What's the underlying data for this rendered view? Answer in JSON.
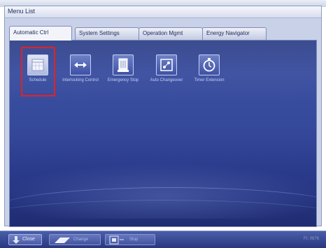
{
  "window": {
    "title": "Menu List"
  },
  "tabs": [
    {
      "label": "Automatic Ctrl",
      "active": true
    },
    {
      "label": "System Settings",
      "active": false
    },
    {
      "label": "Operation Mgmt",
      "active": false
    },
    {
      "label": "Energy Navigator",
      "active": false
    }
  ],
  "menu": {
    "selected": "Schedule",
    "items": [
      {
        "label": "Schedule",
        "icon": "calendar-icon"
      },
      {
        "label": "Interlocking Control",
        "icon": "arrows-icon"
      },
      {
        "label": "Emergency Stop",
        "icon": "emergency-stop-icon"
      },
      {
        "label": "Auto Changeover",
        "icon": "changeover-icon"
      },
      {
        "label": "Timer Extension",
        "icon": "timer-icon"
      }
    ]
  },
  "footer": {
    "close_label": "Close",
    "button_a_label": "Change",
    "button_b_label": "Stop",
    "version": "Ft. 0876"
  },
  "colors": {
    "selection": "#e22222",
    "panel": "#34479a"
  }
}
